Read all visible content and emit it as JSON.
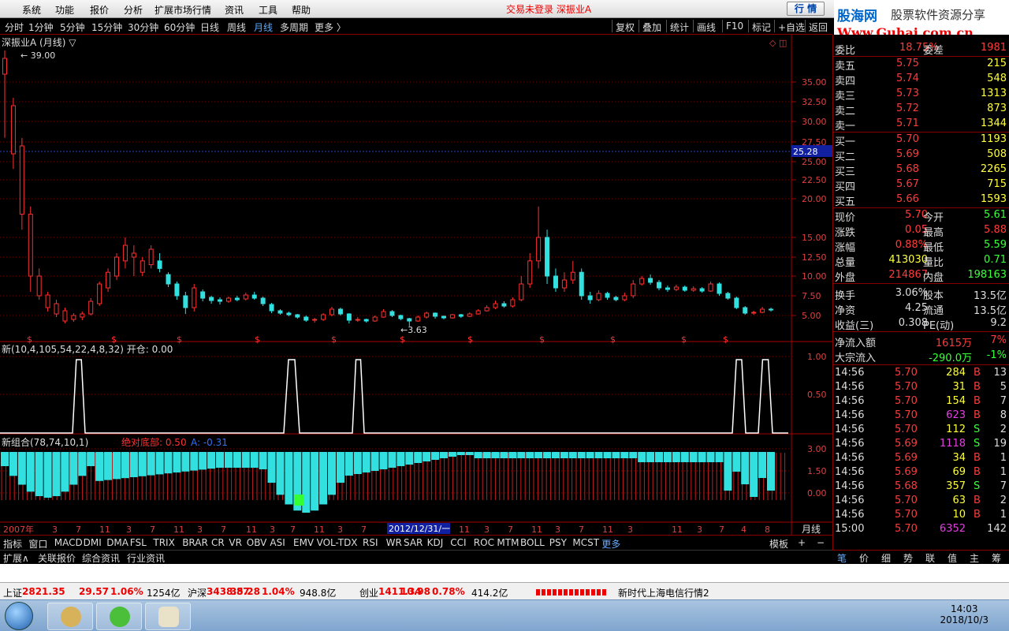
{
  "menu": {
    "items": [
      "系统",
      "功能",
      "报价",
      "分析",
      "扩展市场行情",
      "资讯",
      "工具",
      "帮助"
    ],
    "status": "交易未登录  深振业A",
    "quote_btn": "行 情"
  },
  "logo": {
    "line1": "股海网",
    "line1b": "股票软件资源分享",
    "line2": "Www.Guhai.com.cn"
  },
  "periods": {
    "items": [
      "分时",
      "1分钟",
      "5分钟",
      "15分钟",
      "30分钟",
      "60分钟",
      "日线",
      "周线",
      "月线",
      "多周期",
      "更多 〉"
    ],
    "active": "月线"
  },
  "tools": [
    "复权",
    "叠加",
    "统计",
    "画线",
    "F10",
    "标记",
    "+自选",
    "返回"
  ],
  "chart_data": [
    {
      "type": "candlestick",
      "title": "深振业A (月线) ▽",
      "yaxis_labels": [
        "35.00",
        "32.50",
        "30.00",
        "27.50",
        "25.00",
        "22.50",
        "20.00",
        "15.00",
        "12.50",
        "10.00",
        "7.50",
        "5.00"
      ],
      "current_price_tag": "25.28",
      "high_label": "39.00",
      "low_label": "3.63",
      "marker": "$"
    },
    {
      "type": "line",
      "title": "新(10,4,105,54,22,4,8,32) 开仓: 0.00",
      "yaxis_labels": [
        "1.00",
        "0.50"
      ]
    },
    {
      "type": "bar",
      "title": "新组合(78,74,10,1)",
      "legend": [
        {
          "text": "绝对底部: 0.50",
          "color": "#ff3030"
        },
        {
          "text": "A: -0.31",
          "color": "#3070ff"
        }
      ],
      "yaxis_labels": [
        "3.00",
        "1.50",
        "0.00"
      ]
    }
  ],
  "xaxis": {
    "labels": [
      "2007年",
      "3",
      "7",
      "11",
      "3",
      "7",
      "11",
      "3",
      "7",
      "11",
      "3",
      "7",
      "11",
      "3",
      "7",
      "11",
      "3",
      "7",
      "11",
      "3",
      "7",
      "11",
      "3",
      "7",
      "11",
      "4",
      "8"
    ],
    "cursor": "2012/12/31/一",
    "period": "月线"
  },
  "indicators": [
    "指标",
    "窗口",
    "MACD",
    "DMI",
    "DMA",
    "FSL",
    "TRIX",
    "BRAR",
    "CR",
    "VR",
    "OBV",
    "ASI",
    "EMV",
    "VOL-TDX",
    "RSI",
    "WR",
    "SAR",
    "KDJ",
    "CCI",
    "ROC",
    "MTM",
    "BOLL",
    "PSY",
    "MCST",
    "更多"
  ],
  "ind_right": [
    "模板",
    "+",
    "−"
  ],
  "ext": [
    "扩展∧",
    "关联报价",
    "综合资讯",
    "行业资讯"
  ],
  "order": {
    "header": {
      "k1": "委比",
      "v1": "18.75%",
      "k2": "委差",
      "v2": "1981"
    },
    "asks": [
      {
        "k": "卖五",
        "p": "5.75",
        "v": "215"
      },
      {
        "k": "卖四",
        "p": "5.74",
        "v": "548"
      },
      {
        "k": "卖三",
        "p": "5.73",
        "v": "1313"
      },
      {
        "k": "卖二",
        "p": "5.72",
        "v": "873"
      },
      {
        "k": "卖一",
        "p": "5.71",
        "v": "1344"
      }
    ],
    "bids": [
      {
        "k": "买一",
        "p": "5.70",
        "v": "1193"
      },
      {
        "k": "买二",
        "p": "5.69",
        "v": "508"
      },
      {
        "k": "买三",
        "p": "5.68",
        "v": "2265"
      },
      {
        "k": "买四",
        "p": "5.67",
        "v": "715"
      },
      {
        "k": "买五",
        "p": "5.66",
        "v": "1593"
      }
    ]
  },
  "quote": [
    {
      "k1": "现价",
      "v1": "5.70",
      "c1": "#ff3b3b",
      "k2": "今开",
      "v2": "5.61",
      "c2": "#3bff3b"
    },
    {
      "k1": "涨跌",
      "v1": "0.05",
      "c1": "#ff3b3b",
      "k2": "最高",
      "v2": "5.88",
      "c2": "#ff3b3b"
    },
    {
      "k1": "涨幅",
      "v1": "0.88%",
      "c1": "#ff3b3b",
      "k2": "最低",
      "v2": "5.59",
      "c2": "#3bff3b"
    },
    {
      "k1": "总量",
      "v1": "413030",
      "c1": "#ffff40",
      "k2": "量比",
      "v2": "0.71",
      "c2": "#3bff3b"
    },
    {
      "k1": "外盘",
      "v1": "214867",
      "c1": "#ff3b3b",
      "k2": "内盘",
      "v2": "198163",
      "c2": "#3bff3b"
    },
    {
      "k1": "换手",
      "v1": "3.06%",
      "c1": "#ddd",
      "k2": "股本",
      "v2": "13.5亿",
      "c2": "#ddd"
    },
    {
      "k1": "净资",
      "v1": "4.25",
      "c1": "#ddd",
      "k2": "流通",
      "v2": "13.5亿",
      "c2": "#ddd"
    },
    {
      "k1": "收益(三)",
      "v1": "0.308",
      "c1": "#ddd",
      "k2": "PE(动)",
      "v2": "9.2",
      "c2": "#ddd"
    }
  ],
  "flow": [
    {
      "k": "净流入额",
      "v": "1615万",
      "p": "7%",
      "c": "#ff3b3b"
    },
    {
      "k": "大宗流入",
      "v": "-290.0万",
      "p": "-1%",
      "c": "#3bff3b"
    }
  ],
  "ticks": [
    {
      "t": "14:56",
      "p": "5.70",
      "v": "284",
      "s": "B",
      "n": "13",
      "pc": "#ff3b3b",
      "vc": "#ffff40",
      "sc": "#ff3b3b"
    },
    {
      "t": "14:56",
      "p": "5.70",
      "v": "31",
      "s": "B",
      "n": "5",
      "pc": "#ff3b3b",
      "vc": "#ffff40",
      "sc": "#ff3b3b"
    },
    {
      "t": "14:56",
      "p": "5.70",
      "v": "154",
      "s": "B",
      "n": "7",
      "pc": "#ff3b3b",
      "vc": "#ffff40",
      "sc": "#ff3b3b"
    },
    {
      "t": "14:56",
      "p": "5.70",
      "v": "623",
      "s": "B",
      "n": "8",
      "pc": "#ff3b3b",
      "vc": "#e040e0",
      "sc": "#ff3b3b"
    },
    {
      "t": "14:56",
      "p": "5.70",
      "v": "112",
      "s": "S",
      "n": "2",
      "pc": "#ff3b3b",
      "vc": "#ffff40",
      "sc": "#3bff3b"
    },
    {
      "t": "14:56",
      "p": "5.69",
      "v": "1118",
      "s": "S",
      "n": "19",
      "pc": "#ff3b3b",
      "vc": "#e040e0",
      "sc": "#3bff3b"
    },
    {
      "t": "14:56",
      "p": "5.69",
      "v": "34",
      "s": "B",
      "n": "1",
      "pc": "#ff3b3b",
      "vc": "#ffff40",
      "sc": "#ff3b3b"
    },
    {
      "t": "14:56",
      "p": "5.69",
      "v": "69",
      "s": "B",
      "n": "1",
      "pc": "#ff3b3b",
      "vc": "#ffff40",
      "sc": "#ff3b3b"
    },
    {
      "t": "14:56",
      "p": "5.68",
      "v": "357",
      "s": "S",
      "n": "7",
      "pc": "#ff3b3b",
      "vc": "#ffff40",
      "sc": "#3bff3b"
    },
    {
      "t": "14:56",
      "p": "5.70",
      "v": "63",
      "s": "B",
      "n": "2",
      "pc": "#ff3b3b",
      "vc": "#ffff40",
      "sc": "#ff3b3b"
    },
    {
      "t": "14:56",
      "p": "5.70",
      "v": "10",
      "s": "B",
      "n": "1",
      "pc": "#ff3b3b",
      "vc": "#ffff40",
      "sc": "#ff3b3b"
    },
    {
      "t": "15:00",
      "p": "5.70",
      "v": "6352",
      "s": "",
      "n": "142",
      "pc": "#ff3b3b",
      "vc": "#e040e0",
      "sc": "#ff3b3b"
    }
  ],
  "rtabs": [
    "笔",
    "价",
    "细",
    "势",
    "联",
    "值",
    "主",
    "筹"
  ],
  "status": [
    {
      "label": "上证",
      "v": "2821.35",
      "c": "29.57",
      "pct": "1.06%",
      "amt": "1254亿"
    },
    {
      "label": "沪深",
      "v": "3438.87",
      "c": "35.28",
      "pct": "1.04%",
      "amt": "948.8亿"
    },
    {
      "label": "创业",
      "v": "1411.34",
      "c": "10.98",
      "pct": "0.78%",
      "amt": "414.2亿"
    }
  ],
  "status_right": "新时代上海电信行情2",
  "clock": {
    "time": "14:03",
    "date": "2018/10/3"
  }
}
